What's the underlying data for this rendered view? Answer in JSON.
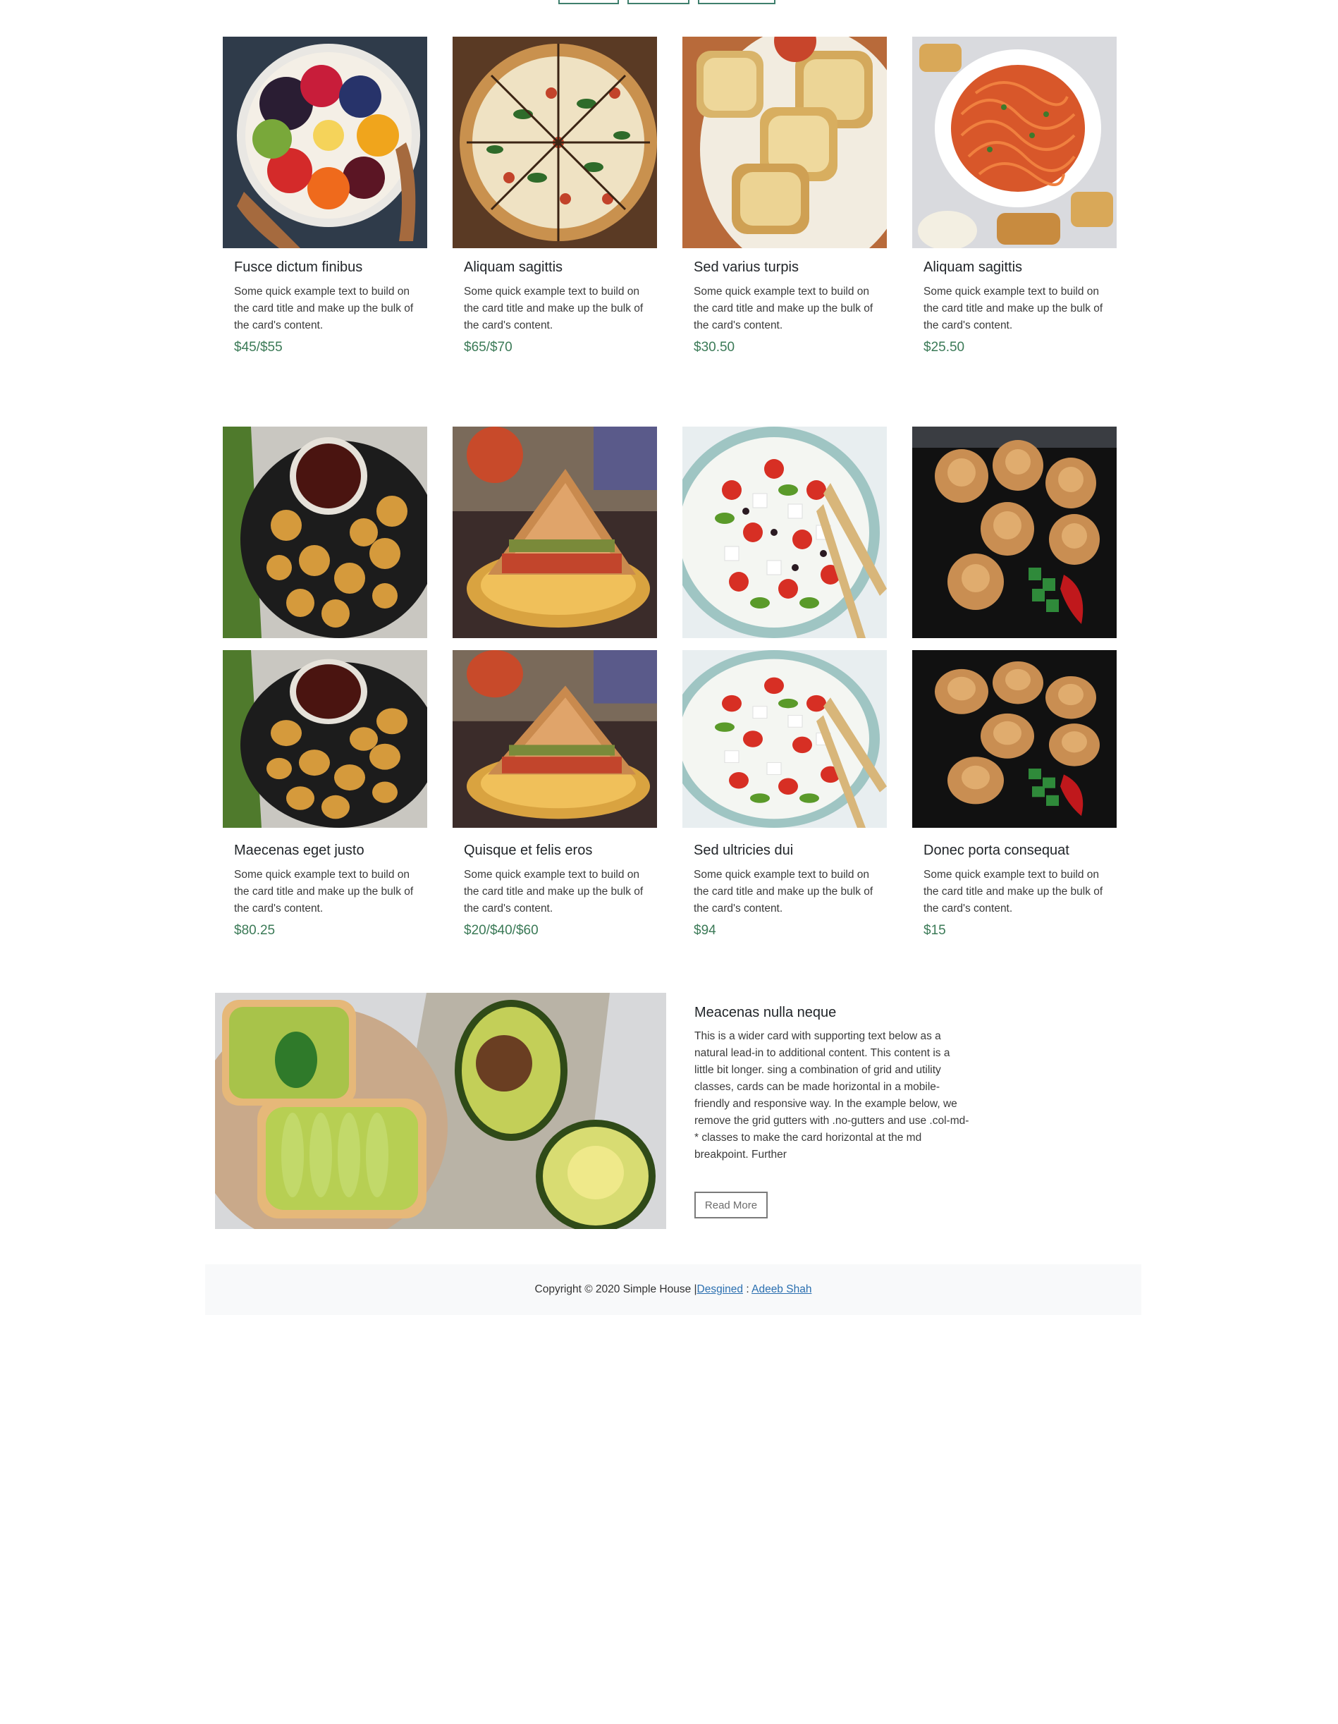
{
  "top_tabs": [
    {
      "label": ""
    },
    {
      "label": ""
    },
    {
      "label": ""
    }
  ],
  "cards_row1": [
    {
      "title": "Fusce dictum finibus",
      "description": "Some quick example text to build on the card title and make up the bulk of the card's content.",
      "price": "$45/$55",
      "image": "fruit-bowl-image"
    },
    {
      "title": "Aliquam sagittis",
      "description": "Some quick example text to build on the card title and make up the bulk of the card's content.",
      "price": "$65/$70",
      "image": "pizza-image"
    },
    {
      "title": "Sed varius turpis",
      "description": "Some quick example text to build on the card title and make up the bulk of the card's content.",
      "price": "$30.50",
      "image": "garlic-bread-image"
    },
    {
      "title": "Aliquam sagittis",
      "description": "Some quick example text to build on the card title and make up the bulk of the card's content.",
      "price": "$25.50",
      "image": "spaghetti-image"
    }
  ],
  "cards_row2": [
    {
      "title": "Maecenas eget justo",
      "description": "Some quick example text to build on the card title and make up the bulk of the card's content.",
      "price": "$80.25",
      "image": "chicken-nuggets-image"
    },
    {
      "title": "Quisque et felis eros",
      "description": "Some quick example text to build on the card title and make up the bulk of the card's content.",
      "price": "$20/$40/$60",
      "image": "sandwich-image"
    },
    {
      "title": "Sed ultricies dui",
      "description": "Some quick example text to build on the card title and make up the bulk of the card's content.",
      "price": "$94",
      "image": "greek-salad-image"
    },
    {
      "title": "Donec porta consequat",
      "description": "Some quick example text to build on the card title and make up the bulk of the card's content.",
      "price": "$15",
      "image": "momos-image"
    }
  ],
  "wide_card": {
    "title": "Meacenas nulla neque",
    "text": "This is a wider card with supporting text below as a natural lead-in to additional content. This content is a little bit longer. sing a combination of grid and utility classes, cards can be made horizontal in a mobile-friendly and responsive way. In the example below, we remove the grid gutters with .no-gutters and use .col-md-* classes to make the card horizontal at the md breakpoint. Further",
    "button_label": "Read More",
    "image": "avocado-toast-image"
  },
  "footer": {
    "copyright": "Copyright © 2020 Simple House |",
    "designed_link": "Desgined",
    "separator": " : ",
    "author_link": "Adeeb Shah"
  },
  "colors": {
    "price": "#3b7a57",
    "tab_border": "#3f7f6d",
    "footer_bg": "#f8f9fa",
    "link": "#2a6fb0"
  }
}
